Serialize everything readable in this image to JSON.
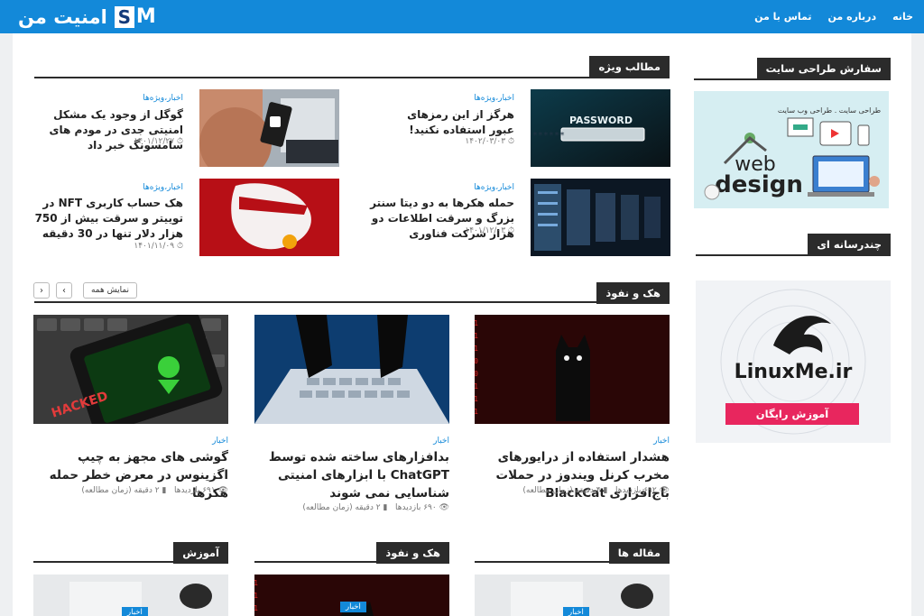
{
  "header": {
    "nav": [
      "خانه",
      "درباره من",
      "تماس با من"
    ],
    "logo_s": "S",
    "logo_m": "M",
    "logo_text": "امنیت من"
  },
  "sidebar": {
    "design_title": "سفارش طراحی سایت",
    "design_banner_caption": "طراحی سایت . طراحی وب سایت",
    "design_banner_word1": "web",
    "design_banner_word2": "design",
    "media_title": "چندرسانه ای",
    "linux_banner_text": "LinuxMe.ir",
    "linux_banner_button": "آموزش رایگان"
  },
  "featured": {
    "title": "مطالب ویژه",
    "items": [
      {
        "category": "اخبار،ویژه‌ها",
        "title": "هرگز از این رمزهای عبور استفاده نکنید!",
        "date": "۱۴۰۲/۰۳/۰۳",
        "image_text": "PASSWORD",
        "image_mask": "*******"
      },
      {
        "category": "اخبار،ویژه‌ها",
        "title": "گوگل از وجود یک مشکل امنیتی جدی در مودم های سامسونگ خبر داد",
        "date": "۱۴۰۱/۱۲/۲۷"
      },
      {
        "category": "اخبار،ویژه‌ها",
        "title": "حمله هکرها به دو دیتا سنتر بزرگ و سرقت اطلاعات دو هزار شرکت فناوری",
        "date": "۱۴۰۱/۱۲/۰۳"
      },
      {
        "category": "اخبار،ویژه‌ها",
        "title": "هک حساب کاربری NFT در توییتر و سرقت بیش از 750 هزار دلار تنها در 30 دقیقه",
        "date": "۱۴۰۱/۱۱/۰۹"
      }
    ]
  },
  "hack": {
    "title": "هک و نفوذ",
    "show_all": "نمایش همه",
    "prev": "‹",
    "next": "›",
    "items": [
      {
        "category": "اخبار",
        "title": "هشدار استفاده از درایورهای مخرب کرنل ویندوز در حملات باج‌افزاری BlackCat",
        "views": "۶۹۲ بازدیدها",
        "read": "۴ دقیقه (زمان مطالعه)"
      },
      {
        "category": "اخبار",
        "title": "بدافزارهای ساخته شده توسط ChatGPT با ابزارهای امنیتی شناسایی نمی شوند",
        "views": "۶۹۰ بازدیدها",
        "read": "۲ دقیقه (زمان مطالعه)"
      },
      {
        "category": "اخبار",
        "title": "گوشی های مجهز به چیپ اگزینوس در معرض خطر حمله هکرها",
        "views": "۶۹۱ بازدیدها",
        "read": "۲ دقیقه (زمان مطالعه)",
        "image_text": "HACKED"
      }
    ]
  },
  "bottom": {
    "sections": [
      "مقاله ها",
      "هک و نفوذ",
      "آموزش"
    ],
    "badges": [
      "اخبار",
      "اخبار",
      "اخبار"
    ]
  },
  "colors": {
    "brand": "#1389d9",
    "dark": "#2b2b2b",
    "pink": "#e8265e"
  }
}
